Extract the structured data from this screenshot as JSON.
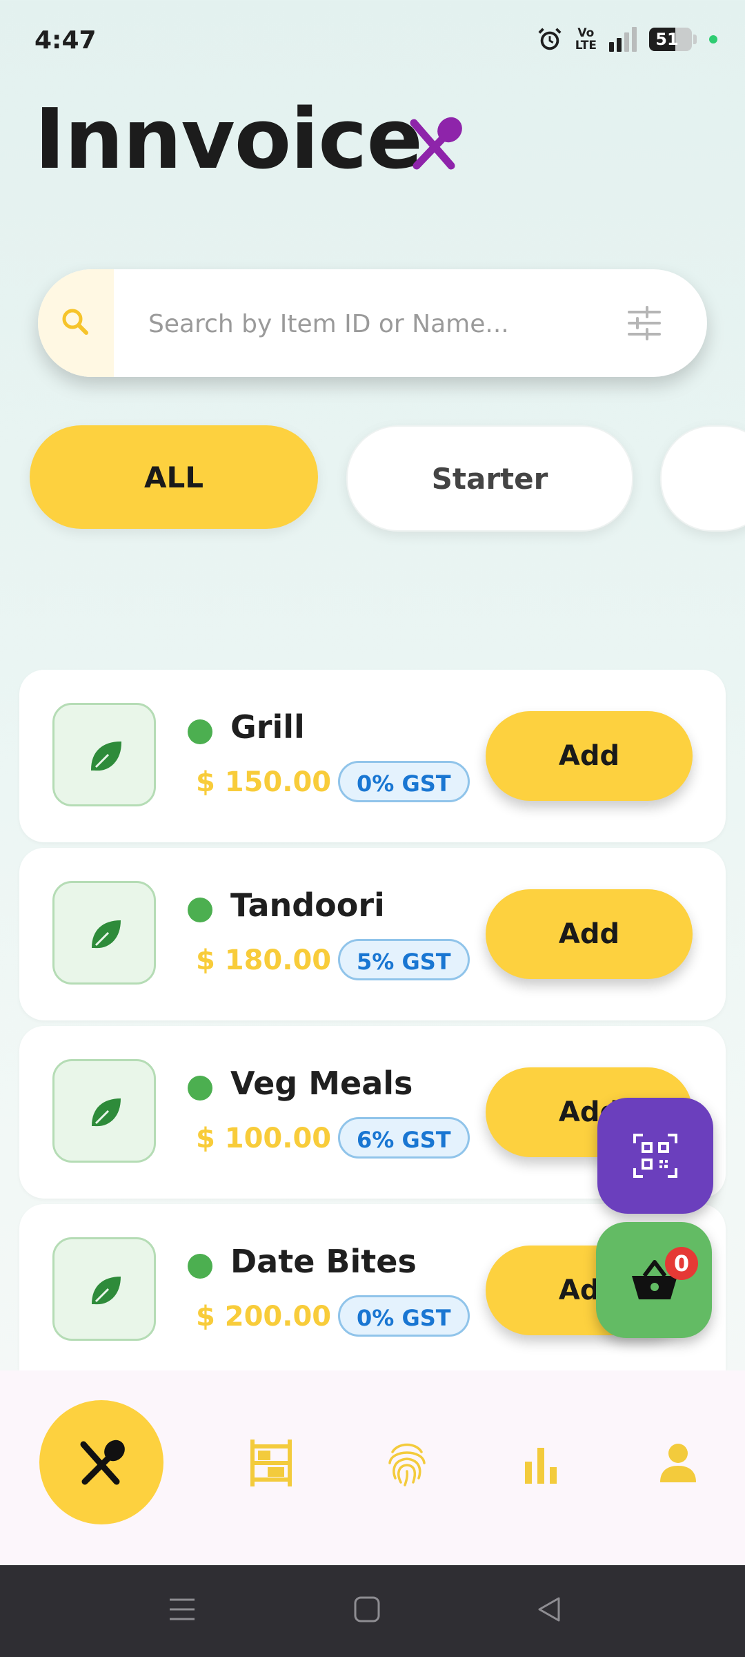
{
  "status_bar": {
    "time": "4:47",
    "volte": "Vo\nLTE",
    "battery_level": "51"
  },
  "header": {
    "title": "Innvoice",
    "title_icon": "fork-spoon-icon",
    "icon_color": "#8e24aa"
  },
  "search": {
    "placeholder": "Search by Item ID or Name...",
    "value": ""
  },
  "categories": [
    {
      "label": "ALL",
      "selected": true
    },
    {
      "label": "Starter",
      "selected": false
    },
    {
      "label": "",
      "selected": false
    }
  ],
  "items": [
    {
      "name": "Grill",
      "price": "$ 150.00",
      "gst": "0% GST",
      "add_label": "Add"
    },
    {
      "name": "Tandoori",
      "price": "$ 180.00",
      "gst": "5% GST",
      "add_label": "Add"
    },
    {
      "name": "Veg Meals",
      "price": "$ 100.00",
      "gst": "6% GST",
      "add_label": "Add"
    },
    {
      "name": "Date Bites",
      "price": "$ 200.00",
      "gst": "0% GST",
      "add_label": "Add"
    }
  ],
  "cart": {
    "count": "0"
  },
  "bottom_nav": [
    {
      "icon": "fork-spoon-icon",
      "active": true
    },
    {
      "icon": "shelf-icon",
      "active": false
    },
    {
      "icon": "fingerprint-icon",
      "active": false
    },
    {
      "icon": "bar-chart-icon",
      "active": false
    },
    {
      "icon": "person-icon",
      "active": false
    }
  ],
  "colors": {
    "accent": "#fdd13f",
    "veg": "#4caf50",
    "qr_fab": "#6b3fbd",
    "cart_fab": "#63bb64",
    "gst_text": "#1976d2"
  }
}
